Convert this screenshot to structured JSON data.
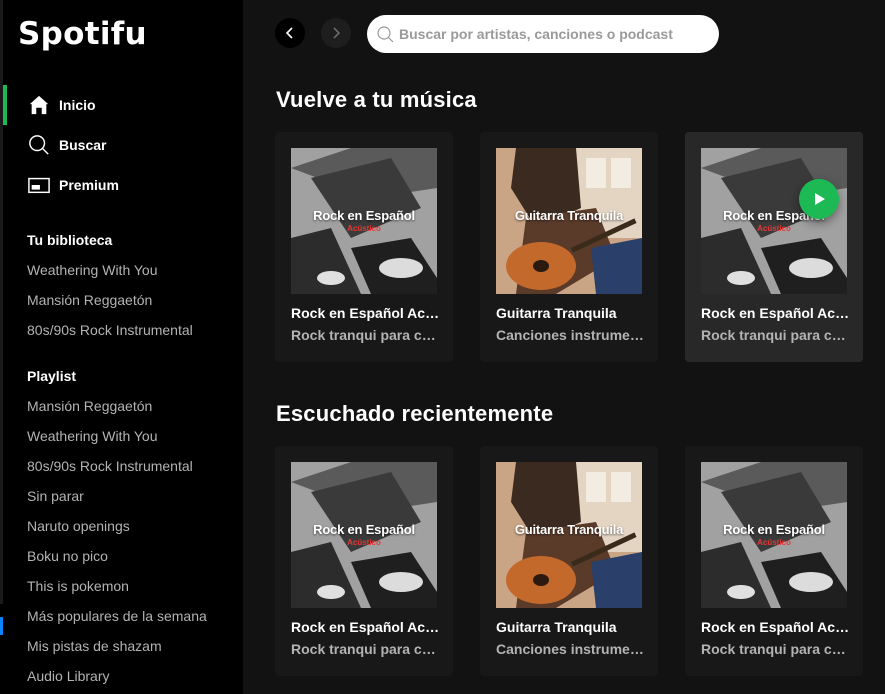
{
  "app": {
    "logo": "Spotifu"
  },
  "nav": [
    {
      "label": "Inicio",
      "icon": "home-icon",
      "active": true
    },
    {
      "label": "Buscar",
      "icon": "search-icon",
      "active": false
    },
    {
      "label": "Premium",
      "icon": "premium-icon",
      "active": false
    }
  ],
  "library": {
    "title": "Tu biblioteca",
    "items": [
      "Weathering With You",
      "Mansión Reggaetón",
      "80s/90s Rock Instrumental"
    ]
  },
  "playlists": {
    "title": "Playlist",
    "items": [
      "Mansión Reggaetón",
      "Weathering With You",
      "80s/90s Rock Instrumental",
      "Sin parar",
      "Naruto openings",
      "Boku no pico",
      "This is pokemon",
      "Más populares de la semana",
      "Mis pistas de shazam",
      "Audio Library"
    ]
  },
  "search": {
    "placeholder": "Buscar por artistas, canciones o podcast"
  },
  "sections": [
    {
      "title": "Vuelve a tu música",
      "cards": [
        {
          "cover_title": "Rock en Español",
          "cover_subtitle": "Acústico",
          "title": "Rock en Español Acústico",
          "subtitle": "Rock tranqui para cantar",
          "cover": "rock"
        },
        {
          "cover_title": "Guitarra Tranquila",
          "cover_subtitle": "",
          "title": "Guitarra Tranquila",
          "subtitle": "Canciones instrumentales",
          "cover": "guitar"
        },
        {
          "cover_title": "Rock en Español",
          "cover_subtitle": "Acústico",
          "title": "Rock en Español Acústico",
          "subtitle": "Rock tranqui para cantar",
          "cover": "rock",
          "hovered": true
        }
      ]
    },
    {
      "title": "Escuchado recientemente",
      "cards": [
        {
          "cover_title": "Rock en Español",
          "cover_subtitle": "Acústico",
          "title": "Rock en Español Acústico",
          "subtitle": "Rock tranqui para cantar",
          "cover": "rock"
        },
        {
          "cover_title": "Guitarra Tranquila",
          "cover_subtitle": "",
          "title": "Guitarra Tranquila",
          "subtitle": "Canciones instrumentales",
          "cover": "guitar"
        },
        {
          "cover_title": "Rock en Español",
          "cover_subtitle": "Acústico",
          "title": "Rock en Español Acústico",
          "subtitle": "Rock tranqui para cantar",
          "cover": "rock"
        }
      ]
    }
  ],
  "colors": {
    "accent": "#1db954",
    "background": "#121212",
    "sidebar": "#000000",
    "card": "#181818",
    "card_hover": "#282828",
    "cover_accent": "#e53935"
  }
}
